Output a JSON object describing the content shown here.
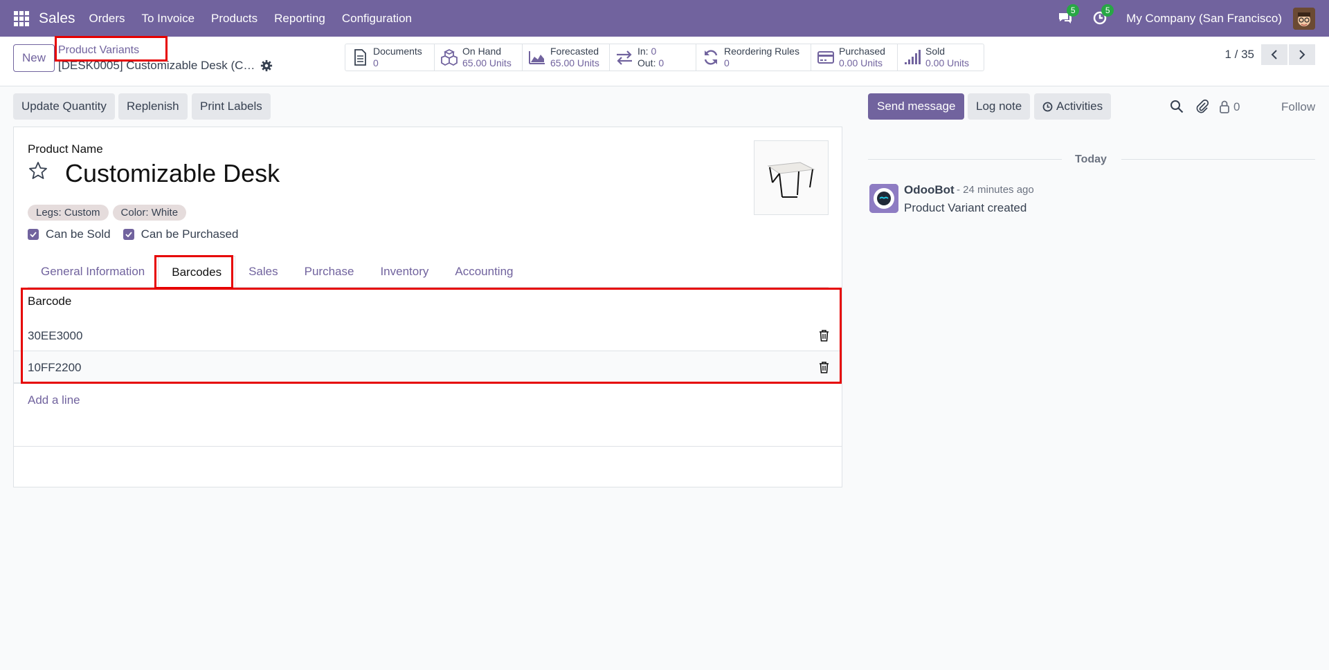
{
  "app": {
    "name": "Sales"
  },
  "nav": {
    "items": [
      "Orders",
      "To Invoice",
      "Products",
      "Reporting",
      "Configuration"
    ]
  },
  "systray": {
    "messages_count": "5",
    "activities_count": "5",
    "company": "My Company (San Francisco)"
  },
  "control_panel": {
    "new_label": "New",
    "breadcrumb": "Product Variants",
    "record_name": "[DESK0005] Customizable Desk (C…",
    "pager": "1 / 35"
  },
  "smart_buttons": [
    {
      "title": "Documents",
      "value": "0",
      "icon": "document-icon"
    },
    {
      "title": "On Hand",
      "value": "65.00 Units",
      "icon": "boxes-icon"
    },
    {
      "title": "Forecasted",
      "value": "65.00 Units",
      "icon": "area-chart-icon"
    },
    {
      "title_in": "In:",
      "value_in": "0",
      "title_out": "Out:",
      "value_out": "0",
      "icon": "exchange-icon"
    },
    {
      "title": "Reordering Rules",
      "value": "0",
      "icon": "refresh-icon"
    },
    {
      "title": "Purchased",
      "value": "0.00 Units",
      "icon": "credit-card-icon"
    },
    {
      "title": "Sold",
      "value": "0.00 Units",
      "icon": "signal-icon"
    }
  ],
  "actions": {
    "update_quantity": "Update Quantity",
    "replenish": "Replenish",
    "print_labels": "Print Labels"
  },
  "form": {
    "product_name_label": "Product Name",
    "product_name": "Customizable Desk",
    "tags": [
      "Legs: Custom",
      "Color: White"
    ],
    "can_be_sold": "Can be Sold",
    "can_be_purchased": "Can be Purchased",
    "tabs": [
      "General Information",
      "Barcodes",
      "Sales",
      "Purchase",
      "Inventory",
      "Accounting"
    ],
    "active_tab": "Barcodes",
    "barcode_header": "Barcode",
    "barcodes": [
      "30EE3000",
      "10FF2200"
    ],
    "add_line": "Add a line"
  },
  "chatter": {
    "send_message": "Send message",
    "log_note": "Log note",
    "activities": "Activities",
    "followers_count": "0",
    "follow": "Follow",
    "date_separator": "Today",
    "message": {
      "author": "OdooBot",
      "time": "- 24 minutes ago",
      "body": "Product Variant created"
    }
  },
  "colors": {
    "brand": "#71639e",
    "highlight": "#e60000",
    "badge": "#28a745"
  }
}
